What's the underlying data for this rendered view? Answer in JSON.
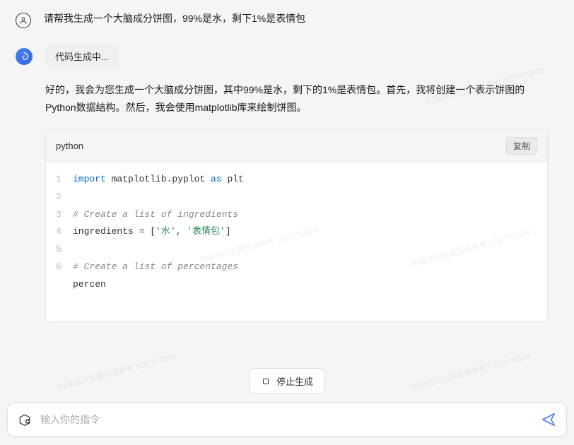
{
  "user_message": "请帮我生成一个大脑成分饼图，99%是水，剩下1%是表情包",
  "assistant": {
    "status": "代码生成中...",
    "text": "好的，我会为您生成一个大脑成分饼图，其中99%是水，剩下的1%是表情包。首先，我将创建一个表示饼图的Python数据结构。然后，我会使用matplotlib库来绘制饼图。"
  },
  "code": {
    "language": "python",
    "copy_label": "复制",
    "lines": [
      {
        "n": "1",
        "tokens": [
          {
            "cls": "kw-import",
            "t": "import"
          },
          {
            "cls": "ident",
            "t": " matplotlib.pyplot "
          },
          {
            "cls": "kw-as",
            "t": "as"
          },
          {
            "cls": "ident",
            "t": " plt"
          }
        ]
      },
      {
        "n": "2",
        "tokens": []
      },
      {
        "n": "3",
        "tokens": [
          {
            "cls": "comment",
            "t": "# Create a list of ingredients"
          }
        ]
      },
      {
        "n": "4",
        "tokens": [
          {
            "cls": "ident",
            "t": "ingredients = ["
          },
          {
            "cls": "string",
            "t": "'水'"
          },
          {
            "cls": "ident",
            "t": ", "
          },
          {
            "cls": "string",
            "t": "'表情包'"
          },
          {
            "cls": "ident",
            "t": "]"
          }
        ]
      },
      {
        "n": "5",
        "tokens": []
      },
      {
        "n": "6",
        "tokens": [
          {
            "cls": "comment",
            "t": "# Create a list of percentages"
          }
        ]
      },
      {
        "n": "",
        "tokens": [
          {
            "cls": "ident",
            "t": "percen"
          }
        ]
      }
    ]
  },
  "controls": {
    "stop_label": "停止生成",
    "input_placeholder": "输入你的指令"
  },
  "watermark": "内容为AI生成仅供参考\n133****0029"
}
